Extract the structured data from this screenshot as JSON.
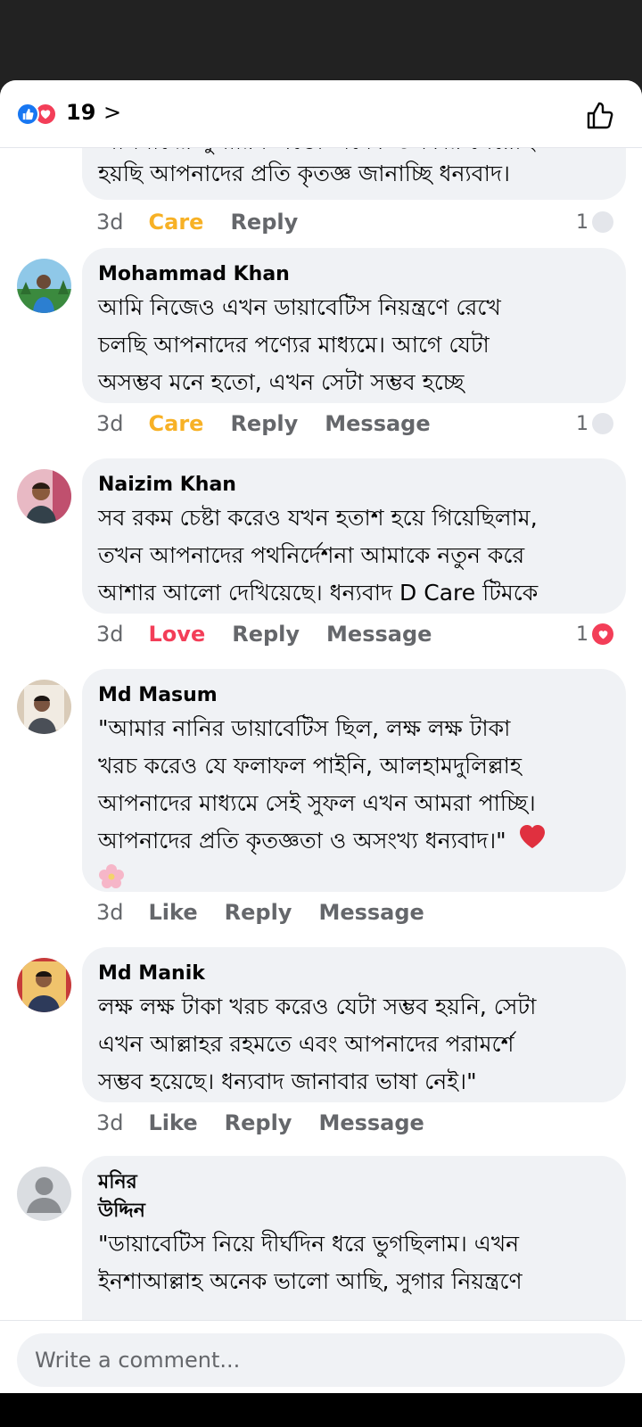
{
  "reactions": {
    "count": "19",
    "chevron": ">"
  },
  "top_partial": {
    "cut_line": "আপনাদের সুপারিশ এতো অনেক উপকার পেয়েছি",
    "text": "হয়ছি আপনাদের প্রতি কৃতজ্ঞ জানাচ্ছি ধন্যবাদ।",
    "time": "3d",
    "reaction_label": "Care",
    "reply": "Reply",
    "count": "1"
  },
  "comments": [
    {
      "author": "Mohammad Khan",
      "lines": [
        "আমি নিজেও এখন ডায়াবেটিস নিয়ন্ত্রণে রেখে",
        "চলছি আপনাদের পণ্যের মাধ্যমে। আগে যেটা",
        "অসম্ভব মনে হতো, এখন সেটা সম্ভব হচ্ছে"
      ],
      "time": "3d",
      "reaction_label": "Care",
      "reply": "Reply",
      "message": "Message",
      "count": "1"
    },
    {
      "author": "Naizim Khan",
      "lines": [
        "সব রকম চেষ্টা করেও যখন হতাশ হয়ে গিয়েছিলাম,",
        "তখন আপনাদের পথনির্দেশনা আমাকে নতুন করে",
        "আশার আলো দেখিয়েছে। ধন্যবাদ D Care টিমকে"
      ],
      "time": "3d",
      "reaction_label": "Love",
      "reply": "Reply",
      "message": "Message",
      "count": "1"
    },
    {
      "author": "Md Masum",
      "lines": [
        "\"আমার নানির ডায়াবেটিস ছিল, লক্ষ লক্ষ টাকা",
        "খরচ করেও যে ফলাফল পাইনি, আলহামদুলিল্লাহ",
        "আপনাদের মাধ্যমে সেই সুফল এখন আমরা পাচ্ছি।",
        "আপনাদের প্রতি কৃতজ্ঞতা ও অসংখ্য ধন্যবাদ।\""
      ],
      "time": "3d",
      "reaction_label": "Like",
      "reply": "Reply",
      "message": "Message"
    },
    {
      "author": "Md Manik",
      "lines": [
        "লক্ষ লক্ষ টাকা খরচ করেও যেটা সম্ভব হয়নি, সেটা",
        "এখন আল্লাহর রহমতে এবং আপনাদের পরামর্শে",
        "সম্ভব হয়েছে। ধন্যবাদ জানাবার ভাষা নেই।\""
      ],
      "time": "3d",
      "reaction_label": "Like",
      "reply": "Reply",
      "message": "Message"
    },
    {
      "author_line1": "মনির",
      "author_line2": "উদ্দিন",
      "lines": [
        "\"ডায়াবেটিস নিয়ে দীর্ঘদিন ধরে ভুগছিলাম। এখন",
        "ইনশাআল্লাহ অনেক ভালো আছি, সুগার নিয়ন্ত্রণে"
      ]
    }
  ],
  "composer": {
    "placeholder": "Write a comment..."
  },
  "colors": {
    "like_blue": "#1877f2",
    "love_red": "#f33e58",
    "care_yellow": "#f7b125",
    "bubble_gray": "#f0f2f5",
    "meta_gray": "#65676b"
  },
  "icons": [
    "like-reaction-icon",
    "love-reaction-icon",
    "thumbs-up-icon",
    "heart-emoji-icon",
    "flower-emoji-icon",
    "default-avatar-icon"
  ]
}
